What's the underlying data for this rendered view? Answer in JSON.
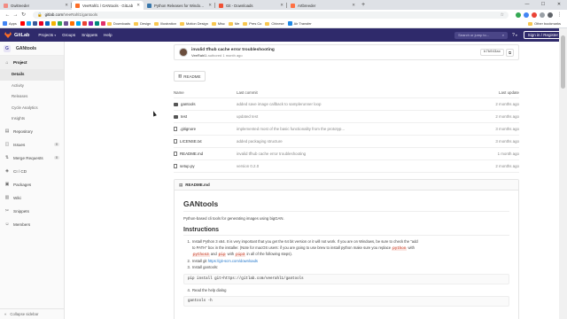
{
  "browser": {
    "tabs": [
      {
        "title": "Gwitreeder",
        "color": "#f28b82"
      },
      {
        "title": "VeeRahl1 / GANtools · GitLab",
        "color": "#fc6d26"
      },
      {
        "title": "Python Releases for Windows | P...",
        "color": "#3776ab"
      },
      {
        "title": "Git - Downloads",
        "color": "#f05033"
      },
      {
        "title": "Artbreeder",
        "color": "#ff7043"
      }
    ],
    "new_tab": "+",
    "url_host": "gitlab.com",
    "url_path": "/VeeRahl1/gantools",
    "bookmarks": [
      {
        "label": "Apps",
        "type": "apps"
      },
      {
        "label": "Downloads",
        "type": "folder"
      },
      {
        "label": "Design",
        "type": "folder"
      },
      {
        "label": "Illustration",
        "type": "folder"
      },
      {
        "label": "Motion Design",
        "type": "folder"
      },
      {
        "label": "Misc",
        "type": "folder"
      },
      {
        "label": "Me",
        "type": "folder"
      },
      {
        "label": "Pres Co",
        "type": "folder"
      },
      {
        "label": "Chinese",
        "type": "folder"
      },
      {
        "label": "Air Transfer",
        "type": "site"
      }
    ],
    "other_bookmarks": "Other bookmarks"
  },
  "gitlab_nav": {
    "logo": "GitLab",
    "links": [
      "Projects",
      "Groups",
      "Snippets",
      "Help"
    ],
    "search_placeholder": "Search or jump to...",
    "signin": "Sign in / Register"
  },
  "sidebar": {
    "avatar_letter": "G",
    "project_name": "GANtools",
    "project_label": "Project",
    "project_sub": [
      "Details",
      "Activity",
      "Releases",
      "Cycle Analytics",
      "Insights"
    ],
    "items": [
      {
        "label": "Repository",
        "icon": "repo-icon",
        "glyph": "▤"
      },
      {
        "label": "Issues",
        "icon": "issues-icon",
        "glyph": "◫",
        "count": "0"
      },
      {
        "label": "Merge Requests",
        "icon": "merge-icon",
        "glyph": "⇅",
        "count": "0"
      },
      {
        "label": "CI / CD",
        "icon": "rocket-icon",
        "glyph": "◈"
      },
      {
        "label": "Packages",
        "icon": "package-icon",
        "glyph": "▣"
      },
      {
        "label": "Wiki",
        "icon": "book-icon",
        "glyph": "▥"
      },
      {
        "label": "Snippets",
        "icon": "scissors-icon",
        "glyph": "✂"
      },
      {
        "label": "Members",
        "icon": "users-icon",
        "glyph": "☺"
      }
    ],
    "collapse": "Collapse sidebar"
  },
  "commit": {
    "title": "invalid tfhub cache error troubleshooting",
    "author": "VeeRahl1",
    "when": "authored 1 month ago",
    "sha": "b7b043ac"
  },
  "readme_button": "README",
  "tree": {
    "headers": [
      "Name",
      "Last commit",
      "Last update"
    ],
    "rows": [
      {
        "name": "gantools",
        "type": "dir",
        "commit": "added save image callback to samplerunner loop",
        "updated": "2 months ago"
      },
      {
        "name": "test",
        "type": "dir",
        "commit": "updated test",
        "updated": "2 months ago"
      },
      {
        "name": ".gitignore",
        "type": "file",
        "commit": "implemented most of the basic functionality from the prototyp...",
        "updated": "3 months ago"
      },
      {
        "name": "LICENSE.txt",
        "type": "file",
        "commit": "added packaging structure",
        "updated": "3 months ago"
      },
      {
        "name": "README.md",
        "type": "file",
        "commit": "invalid tfhub cache error troubleshooting",
        "updated": "1 month ago"
      },
      {
        "name": "setup.py",
        "type": "file",
        "commit": "version 0.2.0",
        "updated": "2 months ago"
      }
    ]
  },
  "readme": {
    "filename": "README.md",
    "h1": "GANtools",
    "intro": "Python-based cli tools for generating images using bigGAN.",
    "h2": "Instructions",
    "step1_a": "Install Python 3 x64. It is very important that you get the 64 bit version or it will not work. If you are on Windows, be sure to check the \"add",
    "step1_b": "to PATH\" box in the installer. (Note for macOS users: if you are going to use brew to install python make sure you replace ",
    "step1_code1": "python",
    "step1_c": " with",
    "step1_code2": "python3",
    "step1_and": " and ",
    "step1_code3": "pip",
    "step1_with": " with ",
    "step1_code4": "pip3",
    "step1_d": " in all of the following steps).",
    "step2_a": "Install git ",
    "step2_link": "https://git-scm.com/downloads",
    "step3": "Install gantools:",
    "cmd1": "pip install git+https://gitlab.com/veerahl1/gantools",
    "step4": "Read the help dialog",
    "cmd2": "gantools -h"
  }
}
